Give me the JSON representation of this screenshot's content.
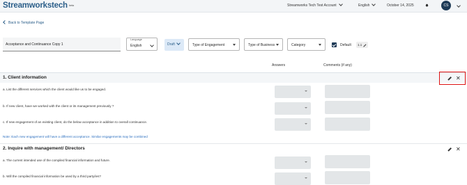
{
  "header": {
    "logo": "Streamworkstech",
    "beta": "beta",
    "account": "Streamworks Tech Test Account",
    "language": "English",
    "date": "October 14, 2025",
    "avatar_initials": "CS"
  },
  "back_link": "Back to Template Page",
  "filters": {
    "template_name": "Acceptance and Continuance Copy 1",
    "language_label": "Language",
    "language_value": "English",
    "status": "Draft",
    "engagement_placeholder": "Type of Engagement",
    "business_placeholder": "Type of Business",
    "category_placeholder": "Category",
    "default_label": "Default",
    "version": "1.1"
  },
  "columns": {
    "answers": "Answers",
    "comments": "Comments (if any)"
  },
  "sections": [
    {
      "title": "1. Client information",
      "questions": [
        "a. List the different services which the client would like us to be engaged.",
        "b. If new client, have we worked with the client or its management previously ?",
        "c. If new engagement of an existing client, do the below acceptance in addition to overall continuance."
      ],
      "note": "Note: Each new engagement will have a different acceptance. Similar engagements may be combined"
    },
    {
      "title": "2. Inquire with management/ Directors",
      "questions": [
        "a. The current intended use of the compiled financial information and future.",
        "b. Will the compiled financial information be used by a third party/ies?"
      ]
    }
  ],
  "icons": {
    "edit": "pencil-icon",
    "close": "close-icon",
    "notification": "bell-icon"
  },
  "colors": {
    "brand": "#2c5f8a",
    "draft_bg": "#dce9f7",
    "note": "#2c6fbf",
    "highlight": "#dd1111"
  }
}
